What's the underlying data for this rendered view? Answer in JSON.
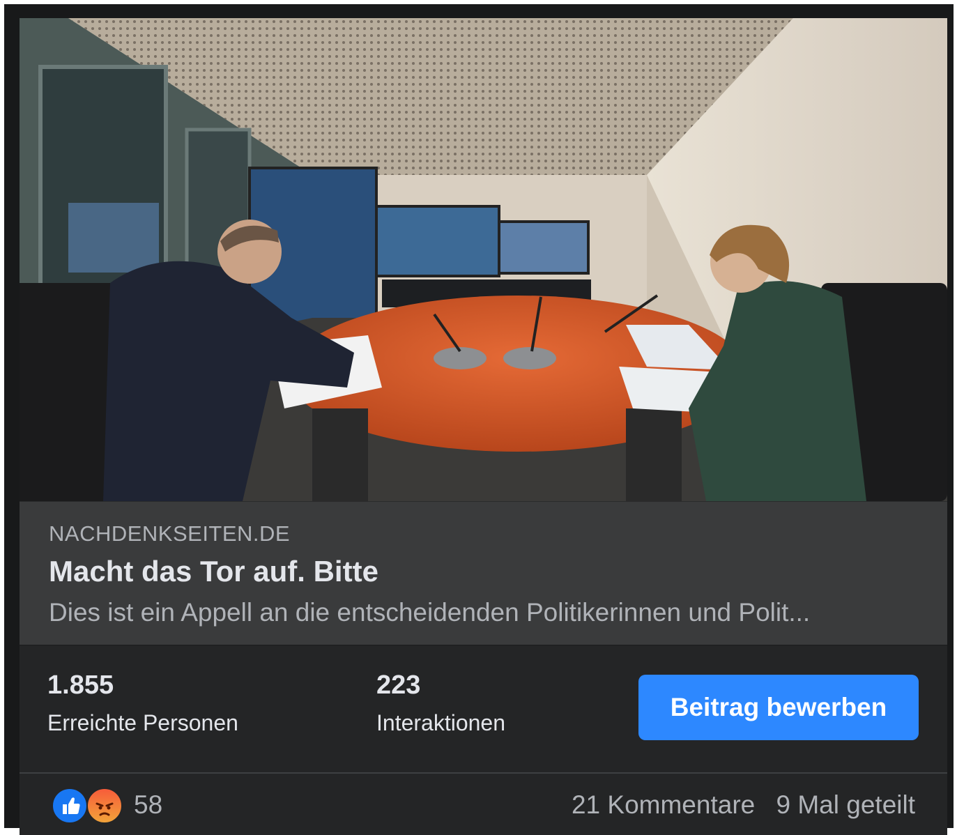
{
  "link": {
    "domain": "NACHDENKSEITEN.DE",
    "title": "Macht das Tor auf. Bitte",
    "description": "Dies ist ein Appell an die entscheidenden Politikerinnen und Polit..."
  },
  "insights": {
    "reach_value": "1.855",
    "reach_label": "Erreichte Personen",
    "interactions_value": "223",
    "interactions_label": "Interaktionen",
    "promote_label": "Beitrag bewerben"
  },
  "reactions": {
    "icons": [
      "like-icon",
      "angry-icon"
    ],
    "count": "58",
    "comments": "21 Kommentare",
    "shares": "9 Mal geteilt"
  },
  "colors": {
    "accent": "#2d88ff",
    "card_bg": "#242526",
    "link_bg": "#3a3b3c",
    "text_primary": "#e4e6eb",
    "text_secondary": "#b0b3b8"
  }
}
